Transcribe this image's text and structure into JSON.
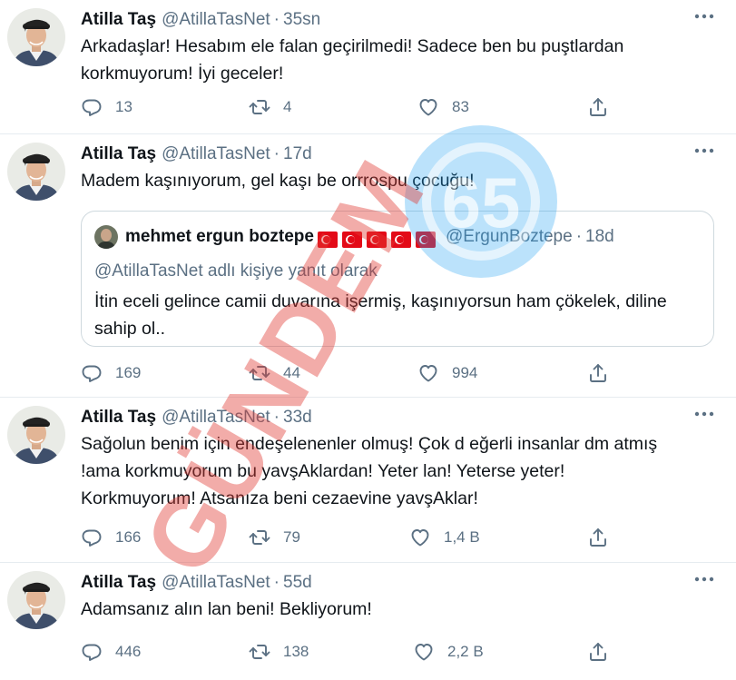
{
  "icons": {
    "reply": "reply-icon",
    "retweet": "retweet-icon",
    "like": "heart-icon",
    "share": "share-icon",
    "more": "more-icon"
  },
  "colors": {
    "text": "#0f1419",
    "secondary": "#5b7083",
    "border": "#e6ecf0",
    "watermark_red": "#e23b34",
    "watermark_blue": "#1da1f2"
  },
  "watermark": {
    "text": "GÜNDEM",
    "badge": "65"
  },
  "tweets": [
    {
      "name": "Atilla Taş",
      "handle": "@AtillaTasNet",
      "sep": "·",
      "time": "35sn",
      "text": "Arkadaşlar! Hesabım ele falan geçirilmedi! Sadece ben bu puştlardan korkmuyorum! İyi geceler!",
      "replies": "13",
      "retweets": "4",
      "likes": "83"
    },
    {
      "name": "Atilla Taş",
      "handle": "@AtillaTasNet",
      "sep": "·",
      "time": "17d",
      "text": "Madem kaşınıyorum, gel kaşı be orrrospu çocuğu!",
      "replies": "169",
      "retweets": "44",
      "likes": "994",
      "quote": {
        "name": "mehmet ergun boztepe",
        "handle": "@ErgunBoztepe",
        "sep": "·",
        "time": "18d",
        "reply_to": "@AtillaTasNet adlı kişiye yanıt olarak",
        "text": "İtin eceli gelince camii duvarına işermiş, kaşınıyorsun ham çökelek, diline sahip ol.."
      }
    },
    {
      "name": "Atilla Taş",
      "handle": "@AtillaTasNet",
      "sep": "·",
      "time": "33d",
      "text": "Sağolun benim için endeşelenenler olmuş! Çok d eğerli insanlar dm atmış !ama korkmuyorum bu yavşAklardan! Yeter lan! Yeterse yeter! Korkmuyorum! Atsanıza beni cezaevine yavşAklar!",
      "replies": "166",
      "retweets": "79",
      "likes": "1,4 B"
    },
    {
      "name": "Atilla Taş",
      "handle": "@AtillaTasNet",
      "sep": "·",
      "time": "55d",
      "text": "Adamsanız alın lan beni! Bekliyorum!",
      "replies": "446",
      "retweets": "138",
      "likes": "2,2 B"
    }
  ]
}
